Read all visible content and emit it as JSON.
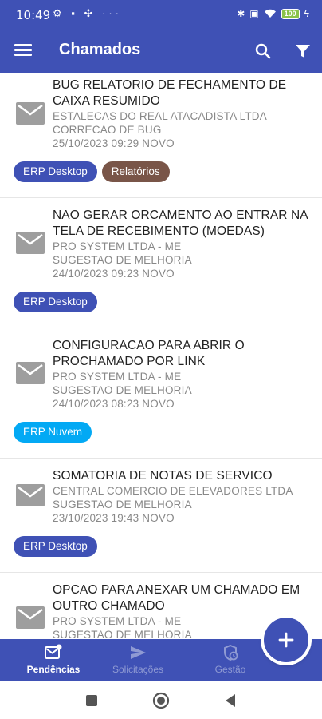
{
  "status_bar": {
    "time": "10:49",
    "battery": "100"
  },
  "app_bar": {
    "title": "Chamados"
  },
  "tickets": [
    {
      "title_line1": "BUG RELATORIO DE FECHAMENTO DE",
      "title_line2": "CAIXA RESUMIDO",
      "company": "ESTALECAS DO REAL ATACADISTA LTDA",
      "type": "CORRECAO DE BUG",
      "datetime_status": "25/10/2023 09:29 NOVO",
      "tags": [
        {
          "label": "ERP Desktop",
          "color": "#3f51b5"
        },
        {
          "label": "Relatórios",
          "color": "#795548"
        }
      ]
    },
    {
      "title_line1": "NAO GERAR ORCAMENTO AO ENTRAR NA",
      "title_line2": "TELA DE RECEBIMENTO (MOEDAS)",
      "company": "PRO SYSTEM LTDA - ME",
      "type": "SUGESTAO DE MELHORIA",
      "datetime_status": "24/10/2023 09:23 NOVO",
      "tags": [
        {
          "label": "ERP Desktop",
          "color": "#3f51b5"
        }
      ]
    },
    {
      "title_line1": "CONFIGURACAO PARA ABRIR O",
      "title_line2": "PROCHAMADO POR LINK",
      "company": "PRO SYSTEM LTDA - ME",
      "type": "SUGESTAO DE MELHORIA",
      "datetime_status": "24/10/2023 08:23 NOVO",
      "tags": [
        {
          "label": "ERP Nuvem",
          "color": "#03a9f4"
        }
      ]
    },
    {
      "title_line1": "SOMATORIA DE NOTAS DE SERVICO",
      "title_line2": "",
      "company": "CENTRAL COMERCIO DE ELEVADORES LTDA",
      "type": "SUGESTAO DE MELHORIA",
      "datetime_status": "23/10/2023 19:43 NOVO",
      "tags": [
        {
          "label": "ERP Desktop",
          "color": "#3f51b5"
        }
      ]
    },
    {
      "title_line1": "OPCAO PARA ANEXAR UM CHAMADO EM",
      "title_line2": "OUTRO CHAMADO",
      "company": "PRO SYSTEM LTDA - ME",
      "type": "SUGESTAO DE MELHORIA",
      "datetime_status": "",
      "tags": []
    }
  ],
  "bottom_nav": [
    {
      "label": "Pendências",
      "icon": "mail-badge-icon",
      "active": true
    },
    {
      "label": "Solicitações",
      "icon": "send-icon",
      "active": false
    },
    {
      "label": "Gestão",
      "icon": "shield-clock-icon",
      "active": false
    }
  ],
  "fab": {
    "icon": "plus-icon"
  },
  "colors": {
    "primary": "#3f51b5",
    "tag_blue": "#3f51b5",
    "tag_brown": "#795548",
    "tag_light_blue": "#03a9f4",
    "mail_icon": "#9e9e9e"
  }
}
